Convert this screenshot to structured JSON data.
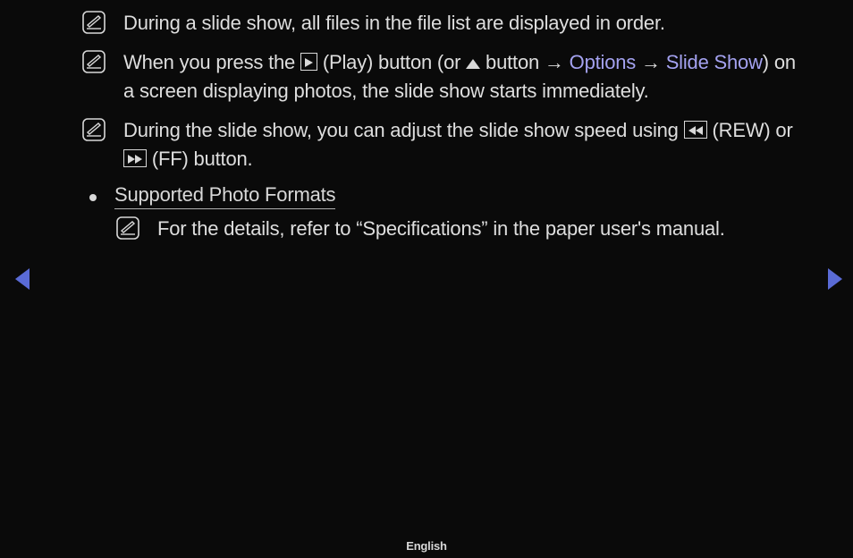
{
  "notes": {
    "n1": "During a slide show, all files in the file list are displayed in order.",
    "n2_a": "When you press the ",
    "n2_b": " (Play) button (or ",
    "n2_c": " button → ",
    "n2_opt": "Options",
    "n2_arrow": " → ",
    "n2_ss": "Slide Show",
    "n2_d": ") on a screen displaying photos, the slide show starts immediately.",
    "n3_a": "During the slide show, you can adjust the slide show speed using ",
    "n3_b": " (REW) or ",
    "n3_c": " (FF) button."
  },
  "section": {
    "heading": "Supported Photo Formats",
    "sub_note": "For the details, refer to “Specifications” in the paper user's manual."
  },
  "footer": "English"
}
